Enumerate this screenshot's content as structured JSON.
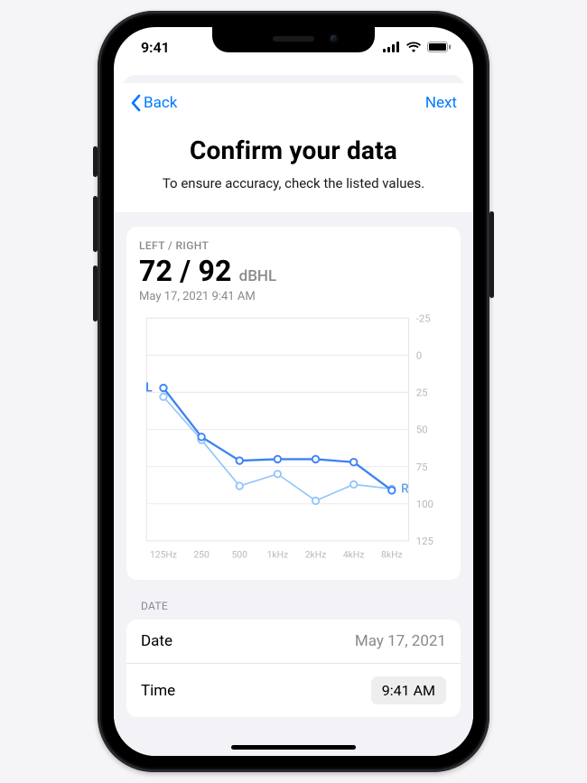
{
  "statusbar": {
    "time": "9:41"
  },
  "nav": {
    "back": "Back",
    "next": "Next"
  },
  "header": {
    "title": "Confirm your data",
    "subtitle": "To ensure accuracy, check the listed values."
  },
  "card": {
    "label": "LEFT / RIGHT",
    "value": "72 / 92",
    "unit": "dBHL",
    "datetime": "May 17, 2021  9:41 AM"
  },
  "chart_data": {
    "type": "line",
    "xlabel": "",
    "ylabel": "",
    "ylim": [
      -25,
      125
    ],
    "y_ticks": [
      -25,
      0,
      25,
      50,
      75,
      100,
      125
    ],
    "categories": [
      "125Hz",
      "250",
      "500",
      "1kHz",
      "2kHz",
      "4kHz",
      "8kHz"
    ],
    "series": [
      {
        "name": "L",
        "color": "#3b82f6",
        "values": [
          22,
          55,
          71,
          70,
          70,
          72,
          91
        ]
      },
      {
        "name": "R",
        "color": "#93c5fd",
        "values": [
          28,
          57,
          88,
          80,
          98,
          87,
          90
        ]
      }
    ]
  },
  "date_section": {
    "label": "DATE",
    "rows": {
      "date": {
        "label": "Date",
        "value": "May 17, 2021"
      },
      "time": {
        "label": "Time",
        "value": "9:41 AM"
      }
    }
  }
}
